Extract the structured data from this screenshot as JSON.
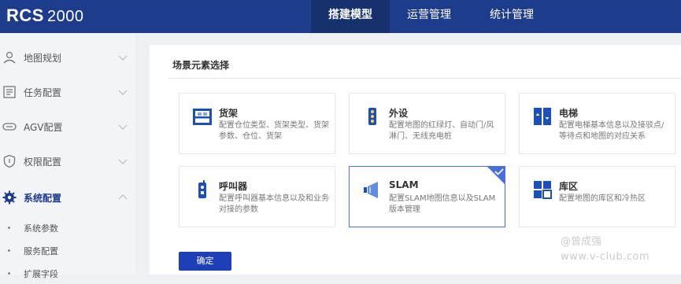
{
  "header": {
    "logo_main": "RCS",
    "logo_version": "2000",
    "tabs": [
      {
        "label": "搭建模型",
        "active": true
      },
      {
        "label": "运营管理",
        "active": false
      },
      {
        "label": "统计管理",
        "active": false
      }
    ]
  },
  "sidebar": {
    "items": [
      {
        "label": "地图规划",
        "icon": "map-person-icon"
      },
      {
        "label": "任务配置",
        "icon": "task-list-icon"
      },
      {
        "label": "AGV配置",
        "icon": "agv-robot-icon"
      },
      {
        "label": "权限配置",
        "icon": "shield-icon"
      },
      {
        "label": "系统配置",
        "icon": "gear-icon",
        "active": true
      }
    ],
    "sub_items": [
      {
        "label": "系统参数"
      },
      {
        "label": "服务配置"
      },
      {
        "label": "扩展字段"
      }
    ]
  },
  "main": {
    "section_title": "场景元素选择",
    "cards": [
      {
        "title": "货架",
        "desc": "配置仓位类型、货架类型、货架参数、仓位、货架",
        "icon": "shelf-icon",
        "selected": false
      },
      {
        "title": "外设",
        "desc": "配置地图的红绿灯、自动门/风淋门、无线充电桩",
        "icon": "traffic-light-icon",
        "selected": false
      },
      {
        "title": "电梯",
        "desc": "配置电梯基本信息以及接驳点/等待点和地图的对应关系",
        "icon": "elevator-icon",
        "selected": false
      },
      {
        "title": "呼叫器",
        "desc": "配置呼叫器基本信息以及和业务对接的参数",
        "icon": "caller-icon",
        "selected": false
      },
      {
        "title": "SLAM",
        "desc": "配置SLAM地图信息以及SLAM版本管理",
        "icon": "slam-icon",
        "selected": true
      },
      {
        "title": "库区",
        "desc": "配置地图的库区和冷热区",
        "icon": "warehouse-area-icon",
        "selected": false
      }
    ],
    "confirm_label": "确定"
  },
  "watermark": {
    "line1": "@曾成强",
    "line2": "www.v-club.com"
  },
  "colors": {
    "topbar": "#1d3c8c",
    "accent": "#1d3fb8",
    "selected_border": "#4a6fd8"
  }
}
